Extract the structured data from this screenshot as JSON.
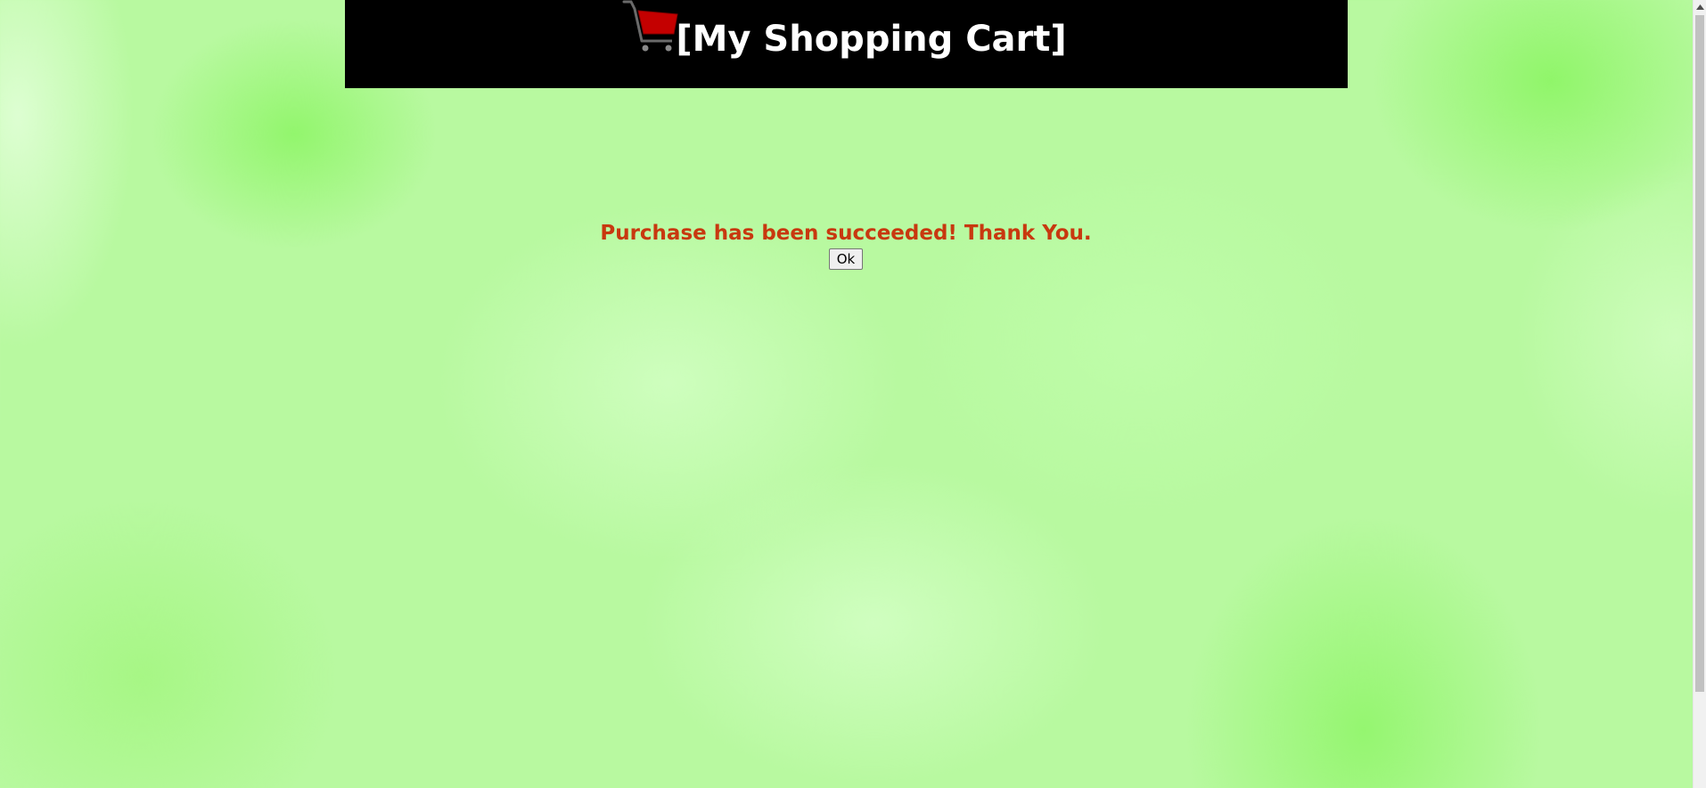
{
  "header": {
    "title": "[My Shopping Cart]",
    "icon": "shopping-cart-icon",
    "background": "#000000",
    "title_color": "#ffffff"
  },
  "main": {
    "message": "Purchase has been succeeded! Thank You.",
    "message_color": "#c8380f",
    "ok_label": "Ok"
  },
  "page": {
    "background_color": "#b8f9a0"
  }
}
